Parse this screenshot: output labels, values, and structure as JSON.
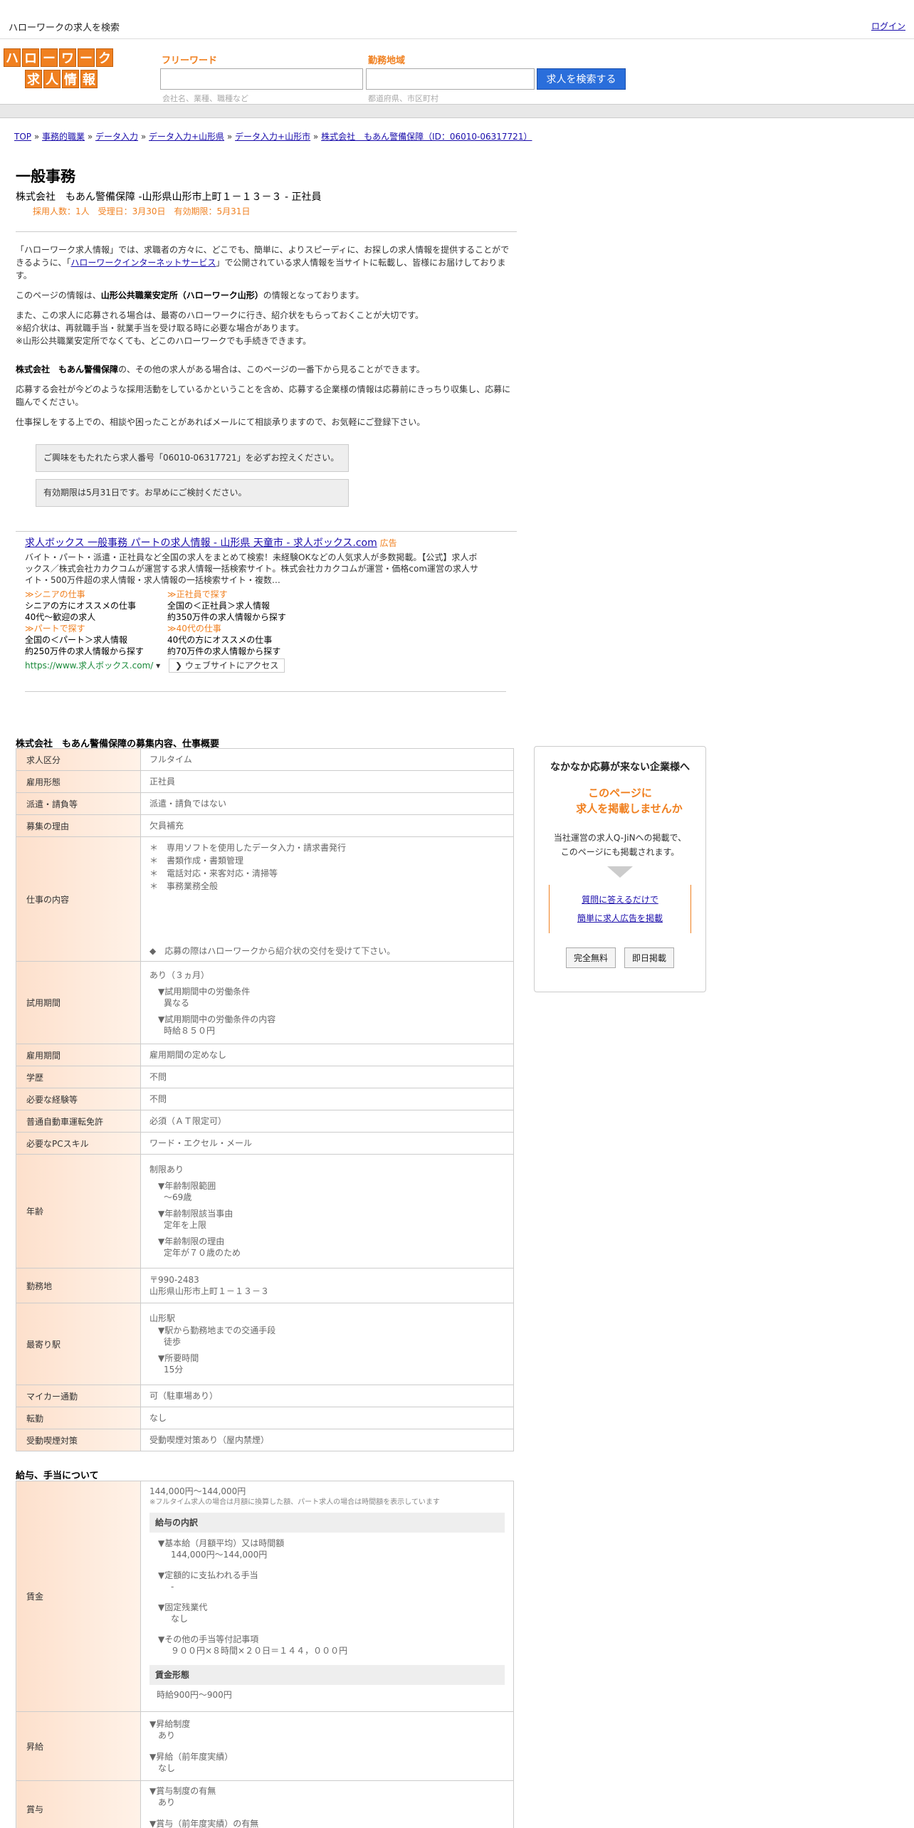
{
  "topbar": {
    "title": "ハローワークの求人を検索",
    "login": "ログイン"
  },
  "logo": {
    "row1": [
      "ハ",
      "ロ",
      "ー",
      "ワ",
      "ー",
      "ク"
    ],
    "row2": [
      "求",
      "人",
      "情",
      "報"
    ]
  },
  "search": {
    "freeword_label": "フリーワード",
    "freeword_placeholder": "会社名、業種、職種など",
    "area_label": "勤務地域",
    "area_placeholder": "都道府県、市区町村",
    "button": "求人を検索する"
  },
  "breadcrumb": [
    {
      "label": "TOP"
    },
    {
      "label": "事務的職業"
    },
    {
      "label": "データ入力"
    },
    {
      "label": "データ入力+山形県"
    },
    {
      "label": "データ入力+山形市"
    },
    {
      "label": "株式会社　もあん警備保障（ID：06010-06317721）"
    }
  ],
  "job": {
    "title": "一般事務",
    "company_line": "株式会社　もあん警備保障 -山形県山形市上町１－１３－３ - 正社員",
    "meta": "採用人数：1人　受理日：3月30日　有効期限：5月31日"
  },
  "intro": {
    "p1a": "「ハローワーク求人情報」では、求職者の方々に、どこでも、簡単に、よりスピーディに、お探しの求人情報を提供することができるように、「",
    "p1link": "ハローワークインターネットサービス",
    "p1b": "」で公開されている求人情報を当サイトに転載し、皆様にお届けしております。",
    "p2a": "このページの情報は、",
    "p2b": "山形公共職業安定所（ハローワーク山形）",
    "p2c": "の情報となっております。",
    "p3": [
      "また、この求人に応募される場合は、最寄のハローワークに行き、紹介状をもらっておくことが大切です。",
      "※紹介状は、再就職手当・就業手当を受け取る時に必要な場合があります。",
      "※山形公共職業安定所でなくても、どこのハローワークでも手続きできます。"
    ],
    "p4a": "株式会社　もあん警備保障",
    "p4b": "の、その他の求人がある場合は、このページの一番下から見ることができます。",
    "p5": "応募する会社が今どのような採用活動をしているかということを含め、応募する企業様の情報は応募前にきっちり収集し、応募に臨んでください。",
    "p6": "仕事探しをする上での、相談や困ったことがあればメールにて相談承りますので、お気軽にご登録下さい。",
    "note1": "ご興味をもたれたら求人番号「06010-06317721」を必ずお控えください。",
    "note2": "有効期限は5月31日です。お早めにご検討ください。"
  },
  "ad": {
    "title": "求人ボックス 一般事務 パートの求人情報 - 山形県 天童市 - 求人ボックス.com",
    "label": "広告",
    "desc": "バイト・パート・派遣・正社員など全国の求人をまとめて検索！未経験OKなどの人気求人が多数掲載。【公式】求人ボックス／株式会社カカクコムが運営する求人情報一括検索サイト。株式会社カカクコムが運営・価格com運営の求人サイト・500万件超の求人情報・求人情報の一括検索サイト・複数…",
    "cells": [
      {
        "h": "≫シニアの仕事",
        "t1": "シニアの方にオススメの仕事",
        "t2": "40代～歓迎の求人"
      },
      {
        "h": "≫正社員で探す",
        "t1": "全国の＜正社員＞求人情報",
        "t2": "約350万件の求人情報から探す"
      },
      {
        "h": "≫パートで探す",
        "t1": "全国の＜パート＞求人情報",
        "t2": "約250万件の求人情報から探す"
      },
      {
        "h": "≫40代の仕事",
        "t1": "40代の方にオススメの仕事",
        "t2": "約70万件の求人情報から探す"
      }
    ],
    "url": "https://www.求人ボックス.com/",
    "btn": "❯ ウェブサイトにアクセス"
  },
  "details": {
    "title": "株式会社　もあん警備保障の募集内容、仕事概要",
    "rows": [
      {
        "k": "求人区分",
        "v": "フルタイム"
      },
      {
        "k": "雇用形態",
        "v": "正社員"
      },
      {
        "k": "派遣・請負等",
        "v": "派遣・請負ではない"
      },
      {
        "k": "募集の理由",
        "v": "欠員補充"
      }
    ],
    "work_label": "仕事の内容",
    "work_items": [
      "＊　専用ソフトを使用したデータ入力・請求書発行",
      "＊　書類作成・書類管理",
      "＊　電話対応・来客対応・清掃等",
      "＊　事務業務全般"
    ],
    "work_note": "◆　応募の際はハローワークから紹介状の交付を受けて下さい。",
    "trial_label": "試用期間",
    "trial": [
      "あり（３ヵ月）",
      "▼試用期間中の労働条件",
      "異なる",
      "▼試用期間中の労働条件の内容",
      "時給８５０円"
    ],
    "rows2": [
      {
        "k": "雇用期間",
        "v": "雇用期間の定めなし"
      },
      {
        "k": "学歴",
        "v": "不問"
      },
      {
        "k": "必要な経験等",
        "v": "不問"
      },
      {
        "k": "普通自動車運転免許",
        "v": "必須（ＡＴ限定可）"
      },
      {
        "k": "必要なPCスキル",
        "v": "ワード・エクセル・メール"
      }
    ],
    "age_label": "年齢",
    "age": [
      "制限あり",
      "▼年齢制限範囲",
      "〜69歳",
      "▼年齢制限該当事由",
      "定年を上限",
      "▼年齢制限の理由",
      "定年が７０歳のため"
    ],
    "loc_label": "勤務地",
    "loc": [
      "〒990-2483",
      "山形県山形市上町１－１３－３"
    ],
    "station_label": "最寄り駅",
    "station": [
      "山形駅",
      "▼駅から勤務地までの交通手段",
      "徒歩",
      "▼所要時間",
      "15分"
    ],
    "rows3": [
      {
        "k": "マイカー通勤",
        "v": "可（駐車場あり）"
      },
      {
        "k": "転勤",
        "v": "なし"
      },
      {
        "k": "受動喫煙対策",
        "v": "受動喫煙対策あり（屋内禁煙）"
      }
    ]
  },
  "salary": {
    "title": "給与、手当について",
    "wage_label": "賃金",
    "wage_range": "144,000円〜144,000円",
    "wage_note": "※フルタイム求人の場合は月額に換算した額、パート求人の場合は時間額を表示しています",
    "breakdown": "給与の内訳",
    "base_h": "▼基本給（月額平均）又は時間額",
    "base_v": "144,000円〜144,000円",
    "fixed_h": "▼定額的に支払われる手当",
    "fixed_v": "-",
    "ot_h": "▼固定残業代",
    "ot_v": "なし",
    "other_h": "▼その他の手当等付記事項",
    "other_v": "９００円×８時間×２０日＝１４４，０００円",
    "form": "賃金形態",
    "form_v": "時給900円〜900円",
    "raise_label": "昇給",
    "raise": [
      "▼昇給制度",
      "あり",
      "▼昇給（前年度実績）",
      "なし"
    ],
    "bonus_label": "賞与",
    "bonus": [
      "▼賞与制度の有無",
      "あり",
      "▼賞与（前年度実績）の有無"
    ]
  },
  "side": {
    "title": "なかなか応募が来ない企業様へ",
    "offer1": "このページに",
    "offer2": "求人を掲載しませんか",
    "desc1": "当社運営の求人Q-JiNへの掲載で、",
    "desc2": "このページにも掲載されます。",
    "link1": "質問に答えるだけで",
    "link2": "簡単に求人広告を掲載",
    "btn1": "完全無料",
    "btn2": "即日掲載"
  }
}
